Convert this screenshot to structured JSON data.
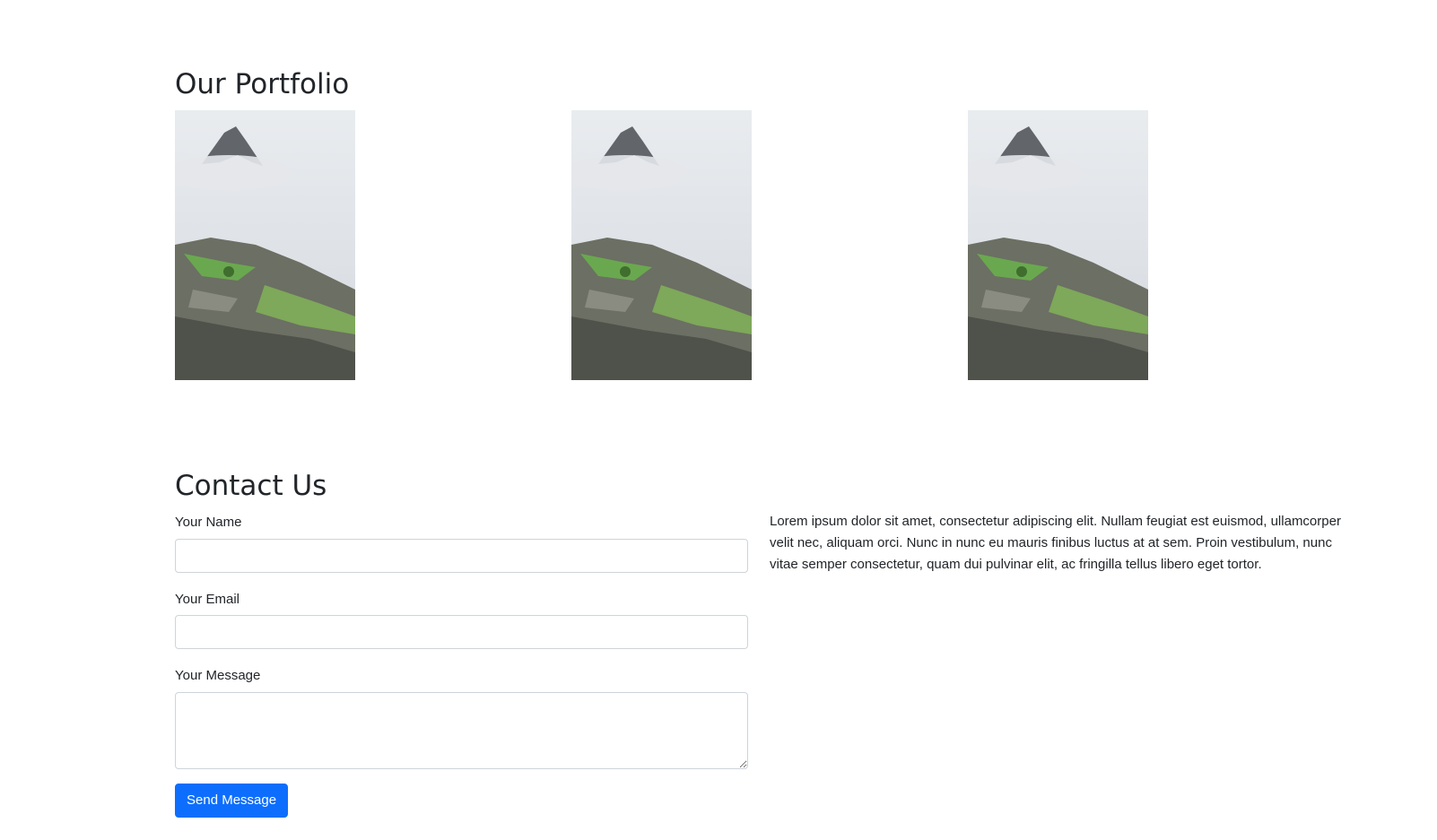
{
  "portfolio": {
    "title": "Our Portfolio",
    "images": [
      {
        "alt": "mountain-ruins-photo"
      },
      {
        "alt": "mountain-ruins-photo"
      },
      {
        "alt": "mountain-ruins-photo"
      }
    ]
  },
  "contact": {
    "title": "Contact Us",
    "name_label": "Your Name",
    "name_value": "",
    "email_label": "Your Email",
    "email_value": "",
    "message_label": "Your Message",
    "message_value": "",
    "submit_label": "Send Message",
    "description": "Lorem ipsum dolor sit amet, consectetur adipiscing elit. Nullam feugiat est euismod, ullamcorper velit nec, aliquam orci. Nunc in nunc eu mauris finibus luctus at at sem. Proin vestibulum, nunc vitae semper consectetur, quam dui pulvinar elit, ac fringilla tellus libero eget tortor."
  },
  "colors": {
    "primary": "#0d6efd",
    "text": "#212529",
    "border": "#ced4da"
  }
}
